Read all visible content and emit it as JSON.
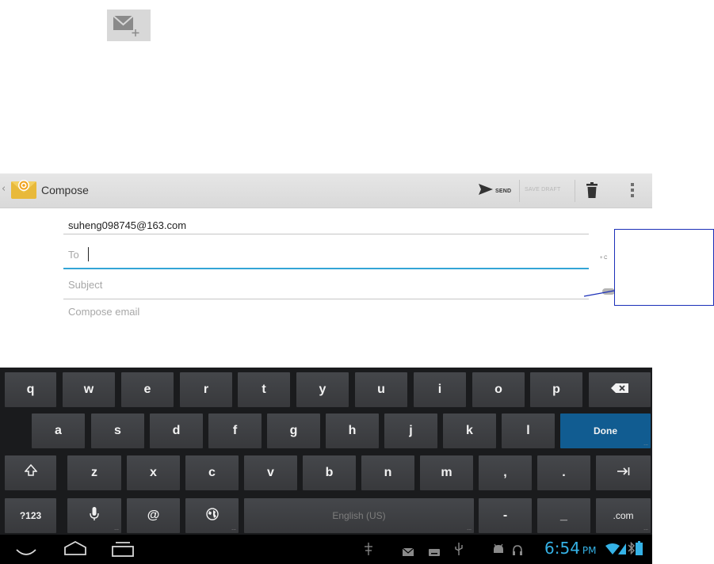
{
  "top_icon": {
    "name": "compose-mail-icon"
  },
  "action_bar": {
    "title": "Compose",
    "send_label": "SEND",
    "save_draft_label": "SAVE DRAFT",
    "icons": [
      "back-icon",
      "email-app-icon",
      "send-icon",
      "delete-icon",
      "overflow-menu-icon"
    ]
  },
  "form": {
    "from_value": "suheng098745@163.com",
    "to_placeholder": "To",
    "cc_hint": "+ C",
    "subject_placeholder": "Subject",
    "body_placeholder": "Compose email"
  },
  "keyboard": {
    "row1": [
      "q",
      "w",
      "e",
      "r",
      "t",
      "y",
      "u",
      "i",
      "o",
      "p"
    ],
    "row2": [
      "a",
      "s",
      "d",
      "f",
      "g",
      "h",
      "j",
      "k",
      "l"
    ],
    "row3": [
      "z",
      "x",
      "c",
      "v",
      "b",
      "n",
      "m",
      ",",
      "."
    ],
    "done_label": "Done",
    "symbols_label": "?123",
    "at_label": "@",
    "space_label": "English (US)",
    "dash_label": "-",
    "underscore_label": "_",
    "dotcom_label": ".com",
    "corner_small": "..."
  },
  "system_bar": {
    "time": "6:54",
    "ampm": "PM",
    "accent_color": "#35b2e6",
    "icons": [
      "back-nav-icon",
      "home-nav-icon",
      "recents-nav-icon",
      "usb-settings-icon",
      "email-notification-icon",
      "keyboard-notification-icon",
      "usb-icon",
      "android-icon",
      "headphones-icon",
      "wifi-icon",
      "signal-icon",
      "bluetooth-icon",
      "battery-icon"
    ]
  }
}
